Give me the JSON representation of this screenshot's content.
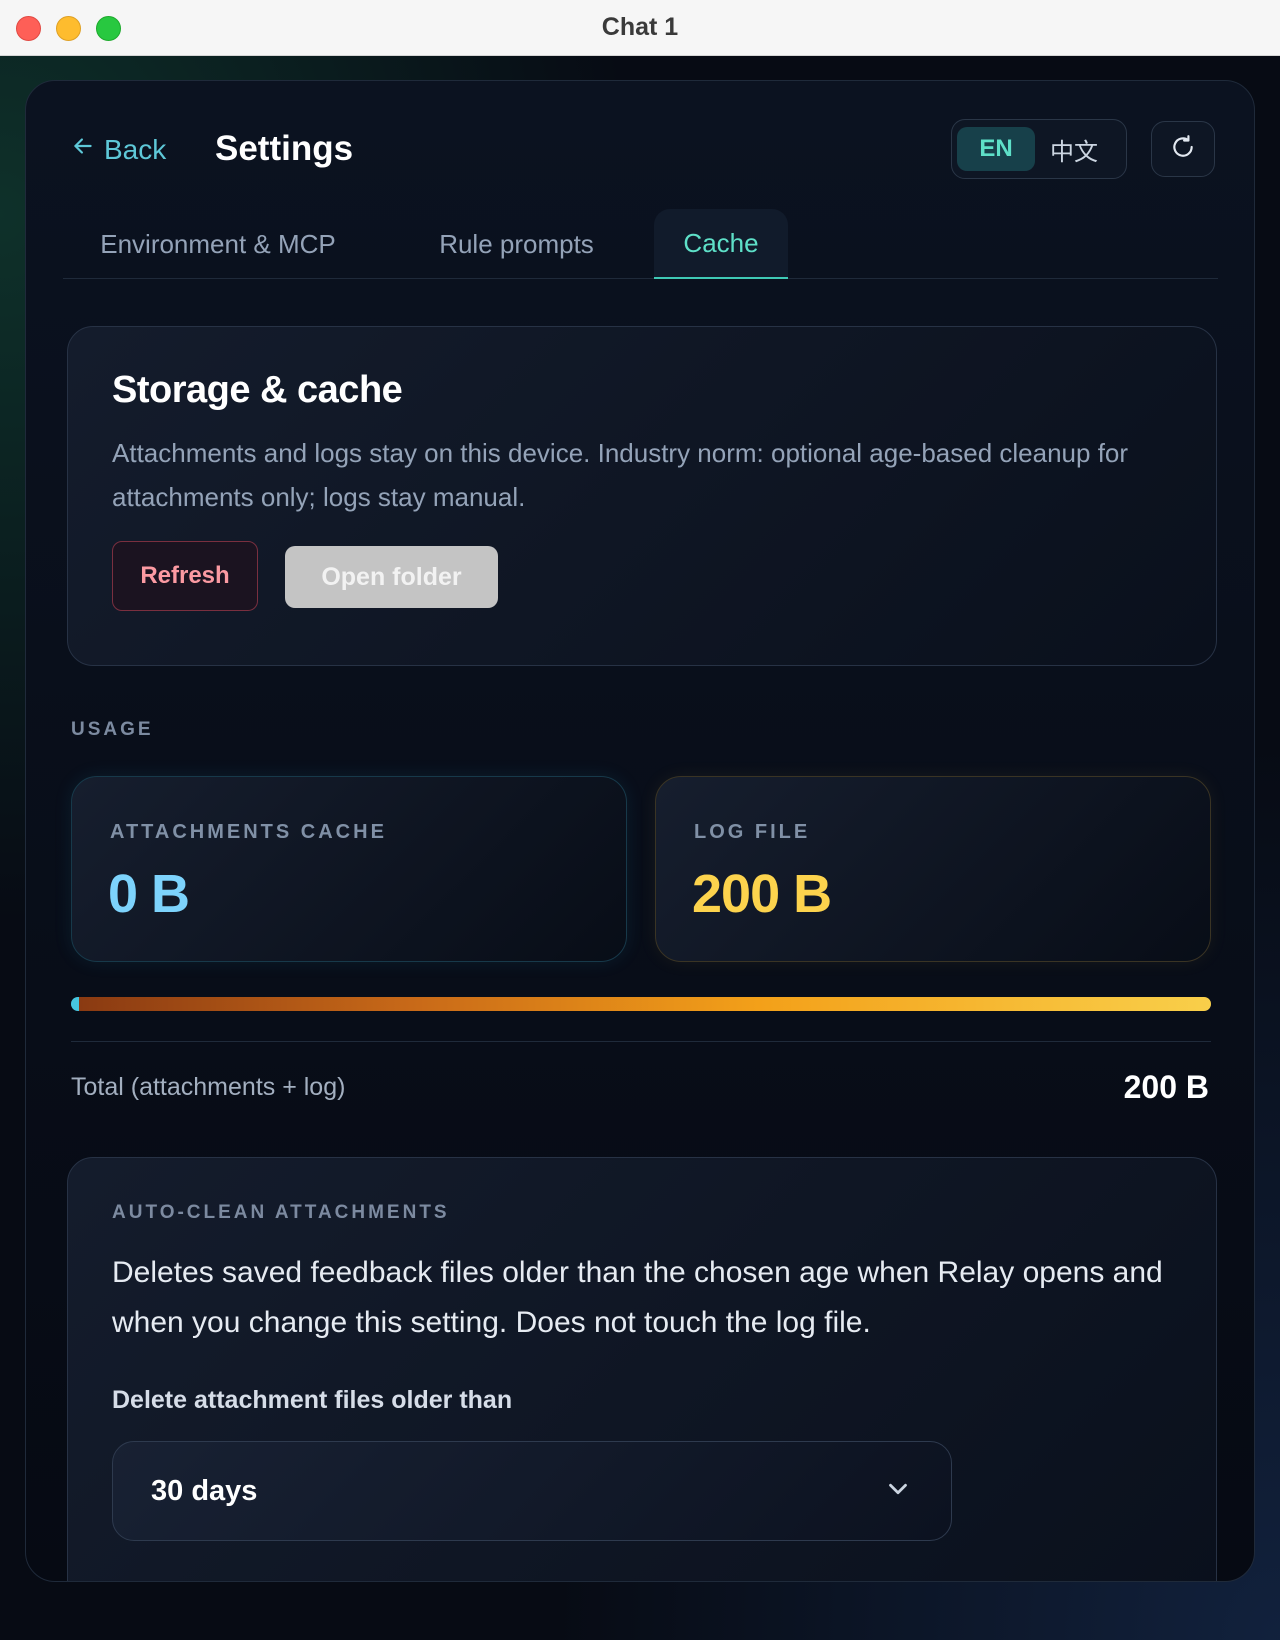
{
  "window": {
    "title": "Chat 1"
  },
  "header": {
    "back_label": "Back",
    "title": "Settings",
    "languages": [
      "EN",
      "中文"
    ],
    "active_language": "EN"
  },
  "tabs": [
    {
      "label": "Environment & MCP"
    },
    {
      "label": "Rule prompts"
    },
    {
      "label": "Cache"
    }
  ],
  "active_tab": "Cache",
  "storage": {
    "title": "Storage & cache",
    "description": "Attachments and logs stay on this device. Industry norm: optional age-based cleanup for attachments only; logs stay manual.",
    "refresh_label": "Refresh",
    "open_folder_label": "Open folder"
  },
  "usage": {
    "section_label": "USAGE",
    "attachments": {
      "label": "ATTACHMENTS CACHE",
      "value": "0 B",
      "bytes": 0
    },
    "log": {
      "label": "LOG FILE",
      "value": "200 B",
      "bytes": 200
    },
    "total_label": "Total (attachments + log)",
    "total_value": "200 B"
  },
  "auto_clean": {
    "section_label": "AUTO-CLEAN ATTACHMENTS",
    "description": "Deletes saved feedback files older than the chosen age when Relay opens and when you change this setting. Does not touch the log file.",
    "field_label": "Delete attachment files older than",
    "selected": "30 days"
  },
  "colors": {
    "accent": "#5ee0c8",
    "attachments": "#7dd3fc",
    "log": "#fcd34d",
    "danger": "#fb9aa2"
  }
}
